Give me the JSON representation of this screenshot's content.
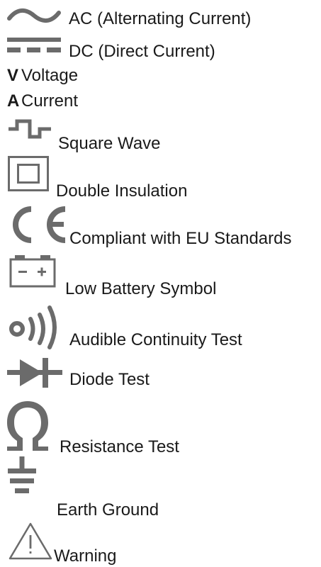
{
  "symbols": [
    {
      "icon": "ac-wave-icon",
      "label": "AC (Alternating Current)"
    },
    {
      "icon": "dc-lines-icon",
      "label": "DC (Direct Current)"
    },
    {
      "letter": "V",
      "label": "Voltage"
    },
    {
      "letter": "A",
      "label": "Current"
    },
    {
      "icon": "square-wave-icon",
      "label": "Square Wave"
    },
    {
      "icon": "double-insulation-icon",
      "label": "Double Insulation"
    },
    {
      "icon": "ce-mark-icon",
      "label": "Compliant with EU Standards"
    },
    {
      "icon": "low-battery-icon",
      "label": "Low Battery Symbol"
    },
    {
      "icon": "continuity-sound-icon",
      "label": "Audible Continuity Test"
    },
    {
      "icon": "diode-icon",
      "label": "Diode Test"
    },
    {
      "icon": "ohm-icon",
      "label": "Resistance Test"
    },
    {
      "icon": "earth-ground-icon",
      "label": "Earth Ground"
    },
    {
      "icon": "warning-triangle-icon",
      "label": "Warning"
    }
  ],
  "colors": {
    "icon": "#6b6b6b",
    "text": "#1a1a1a",
    "background": "#ffffff"
  }
}
